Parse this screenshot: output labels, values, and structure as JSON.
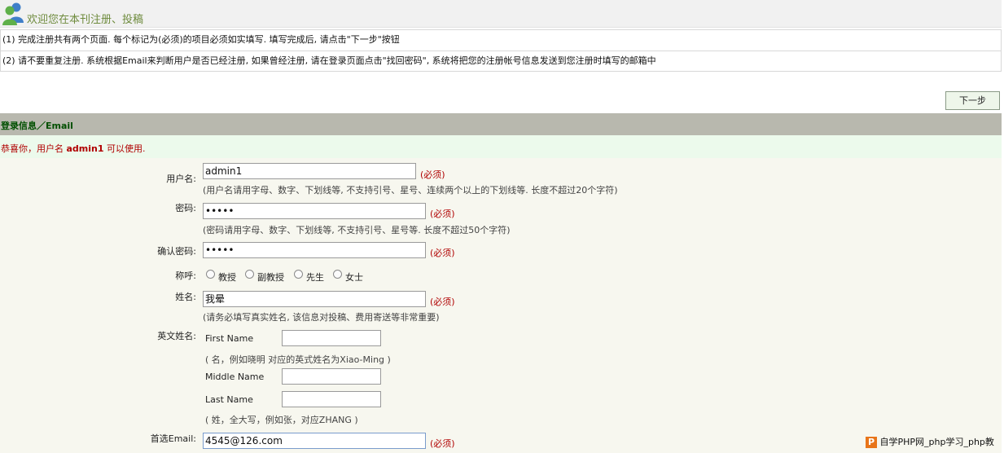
{
  "header": {
    "title": "欢迎您在本刊注册、投稿",
    "icon": "users-icon"
  },
  "notes": [
    "(1) 完成注册共有两个页面. 每个标记为(必须)的项目必须如实填写. 填写完成后, 请点击\"下一步\"按钮",
    "(2) 请不要重复注册. 系统根据Email来判断用户是否已经注册, 如果曾经注册, 请在登录页面点击\"找回密码\", 系统将把您的注册帐号信息发送到您注册时填写的邮箱中"
  ],
  "next_button": "下一步",
  "section_title": "登录信息／Email",
  "message": {
    "prefix": "恭喜你，用户名 ",
    "username": "admin1",
    "suffix": " 可以使用."
  },
  "form": {
    "required_mark": "(必须)",
    "username": {
      "label": "用户名:",
      "value": "admin1",
      "hint": "(用户名请用字母、数字、下划线等, 不支持引号、星号、连续两个以上的下划线等. 长度不超过20个字符)"
    },
    "password": {
      "label": "密码:",
      "value": "•••••",
      "hint": "(密码请用字母、数字、下划线等, 不支持引号、星号等. 长度不超过50个字符)"
    },
    "confirm_password": {
      "label": "确认密码:",
      "value": "•••••"
    },
    "title": {
      "label": "称呼:",
      "options": [
        "教授",
        "副教授",
        "先生",
        "女士"
      ]
    },
    "name": {
      "label": "姓名:",
      "value": "我晕",
      "hint": "(请务必填写真实姓名, 该信息对投稿、费用寄送等非常重要)"
    },
    "english_name": {
      "label": "英文姓名:",
      "first_name": {
        "label": "First Name",
        "value": "",
        "hint": "( 名，例如晓明 对应的英式姓名为Xiao-Ming )"
      },
      "middle_name": {
        "label": "Middle Name",
        "value": ""
      },
      "last_name": {
        "label": "Last Name",
        "value": "",
        "hint": "( 姓，全大写，例如张，对应ZHANG )"
      }
    },
    "email": {
      "label": "首选Email:",
      "value": "4545@126.com"
    }
  },
  "watermark": {
    "badge": "P",
    "text": "自学PHP网_php学习_php教"
  }
}
